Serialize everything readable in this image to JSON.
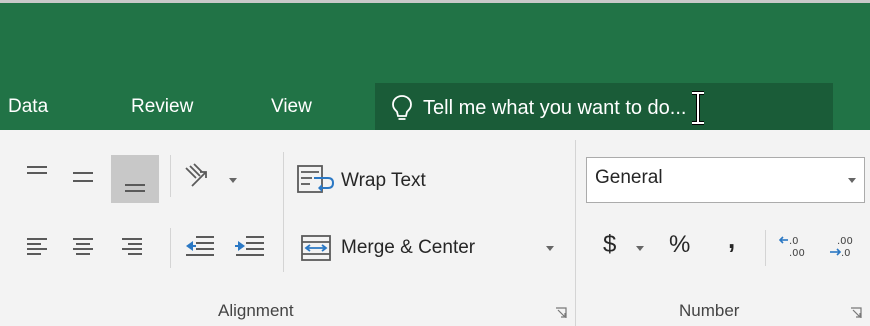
{
  "tabs": [
    "Data",
    "Review",
    "View"
  ],
  "tell_me": {
    "placeholder": "Tell me what you want to do..."
  },
  "alignment": {
    "wrap_text_label": "Wrap Text",
    "merge_center_label": "Merge & Center",
    "group_label": "Alignment"
  },
  "number": {
    "format_value": "General",
    "currency_symbol": "$",
    "percent_symbol": "%",
    "comma_symbol": ",",
    "group_label": "Number"
  },
  "colors": {
    "accent": "#217346",
    "tell_me_bg": "#1a5c38",
    "ribbon_bg": "#f3f3f3",
    "pressed": "#c8c8c8",
    "blue_icon": "#2b78c4"
  }
}
